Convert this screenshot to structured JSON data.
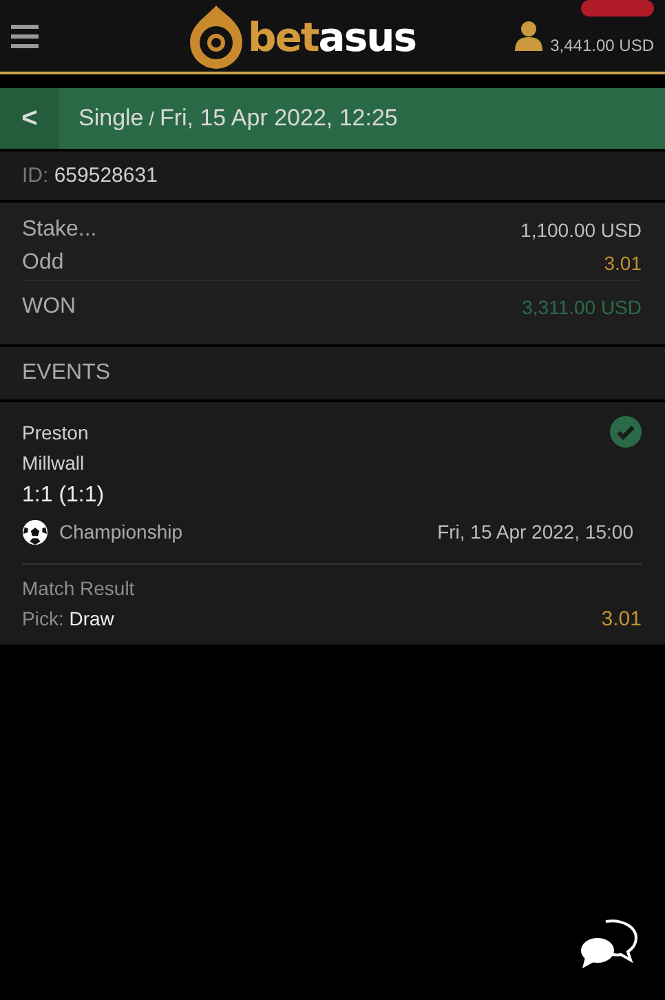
{
  "header": {
    "logo": [
      {
        "text": "bet",
        "color": "#d39a3c"
      },
      {
        "text": "asus",
        "color": "#ffffff"
      }
    ],
    "balance": "3,441.00 USD"
  },
  "title_bar": {
    "back": "<",
    "type": "Single",
    "separator": "/",
    "date": "Fri, 15 Apr 2022, 12:25"
  },
  "bet_id": {
    "label": "ID:",
    "value": "659528631"
  },
  "summary": [
    {
      "label": "Stake...",
      "value": "1,100.00 USD",
      "kind": "plain"
    },
    {
      "label": "Odd",
      "value": "3.01",
      "kind": "odd"
    },
    {
      "label": "WON",
      "value": "3,311.00 USD",
      "kind": "won"
    }
  ],
  "events_heading": "EVENTS",
  "events": [
    {
      "home": "Preston",
      "away": "Millwall",
      "score": "1:1 (1:1)",
      "won": true,
      "league": "Championship",
      "start": "Fri, 15 Apr 2022, 15:00",
      "market": "Match Result",
      "pick_label": "Pick:",
      "pick": "Draw",
      "odd": "3.01"
    }
  ]
}
